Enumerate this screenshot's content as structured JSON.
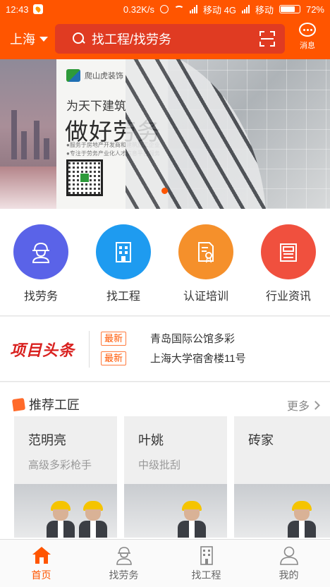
{
  "status_bar": {
    "time": "12:43",
    "speed": "0.32K/s",
    "carrier1": "移动 4G",
    "carrier2": "移动",
    "battery": "72%"
  },
  "header": {
    "city": "上海",
    "search_placeholder": "找工程/找劳务",
    "message_label": "消息"
  },
  "banner": {
    "brand": "爬山虎装饰",
    "line1": "为天下建筑",
    "line2": "做好劳务",
    "notes": [
      "●服务于房地产开发商和建筑施工企业",
      "●专注于劳务产业化人才信息平台服务"
    ]
  },
  "categories": [
    {
      "label": "找劳务",
      "icon": "worker-helmet-icon",
      "color": "#5a63e8"
    },
    {
      "label": "找工程",
      "icon": "building-icon",
      "color": "#1e9bf0"
    },
    {
      "label": "认证培训",
      "icon": "certificate-icon",
      "color": "#f5902b"
    },
    {
      "label": "行业资讯",
      "icon": "newspaper-icon",
      "color": "#f0503e"
    }
  ],
  "headlines": {
    "logo": "项目头条",
    "items": [
      {
        "tag": "最新",
        "text": "青岛国际公馆多彩"
      },
      {
        "tag": "最新",
        "text": "上海大学宿舍楼11号"
      }
    ]
  },
  "recommend": {
    "title": "推荐工匠",
    "more": "更多",
    "workers": [
      {
        "name": "范明亮",
        "skill": "高级多彩枪手"
      },
      {
        "name": "叶姚",
        "skill": "中级批刮"
      },
      {
        "name": "砖家",
        "skill": ""
      }
    ]
  },
  "tabs": [
    {
      "label": "首页",
      "icon": "home-icon",
      "active": true
    },
    {
      "label": "找劳务",
      "icon": "worker-helmet-icon",
      "active": false
    },
    {
      "label": "找工程",
      "icon": "building-icon",
      "active": false
    },
    {
      "label": "我的",
      "icon": "user-icon",
      "active": false
    }
  ],
  "colors": {
    "brand": "#ff5500",
    "search_bg": "#e03b22",
    "headline_red": "#d9211f"
  }
}
